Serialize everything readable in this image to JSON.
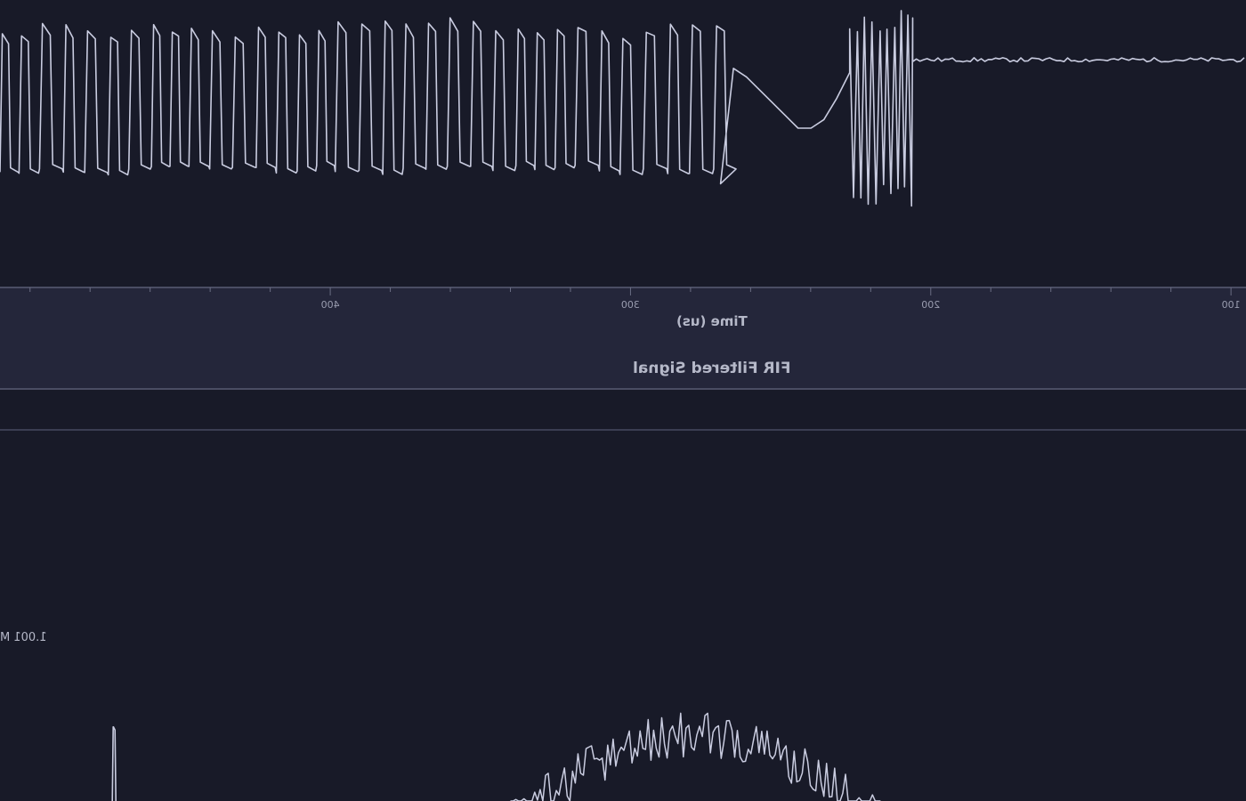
{
  "chart_data": [
    {
      "type": "line",
      "title": "",
      "xlabel": "Time (us)",
      "ylabel": "",
      "x_reversed": true,
      "xlim": [
        510,
        95
      ],
      "x_ticks": [
        400,
        300,
        200,
        100
      ],
      "x_tick_labels": [
        "400",
        "300",
        "200",
        "100"
      ],
      "ylim": [
        -1.3,
        1.2
      ],
      "grid": false,
      "series": [
        {
          "color": "#c9cce0",
          "segments": [
            {
              "kind": "square",
              "x_start": 510,
              "x_end": 270,
              "period": 7.2,
              "high": 0.95,
              "low": -0.85
            },
            {
              "kind": "decay",
              "x_start": 270,
              "x_end": 227,
              "values": [
                -0.95,
                0.4,
                0.3,
                0.15,
                0.0,
                -0.15,
                -0.3,
                -0.3,
                -0.2,
                0.05,
                0.35
              ]
            },
            {
              "kind": "burst",
              "x_start": 227,
              "x_end": 206,
              "period": 2.4,
              "high": 1.1,
              "low": -1.25
            },
            {
              "kind": "flat",
              "x_start": 206,
              "x_end": 95,
              "level": 0.5,
              "noise": 0.025
            }
          ]
        }
      ]
    },
    {
      "type": "line",
      "title": "FIR Filtered Signal",
      "xlabel": "",
      "ylabel": "",
      "x_reversed": true,
      "xlim": [
        510,
        95
      ],
      "y_tick_labels": [
        "1.001 M"
      ],
      "grid": false,
      "series": [
        {
          "color": "#c9cce0",
          "segments": [
            {
              "kind": "spike",
              "x": 472,
              "peak": 0.62
            },
            {
              "kind": "noisy-hump",
              "x_start": 340,
              "x_end": 216,
              "peak": 0.74,
              "noise": 0.12
            }
          ]
        }
      ]
    }
  ]
}
